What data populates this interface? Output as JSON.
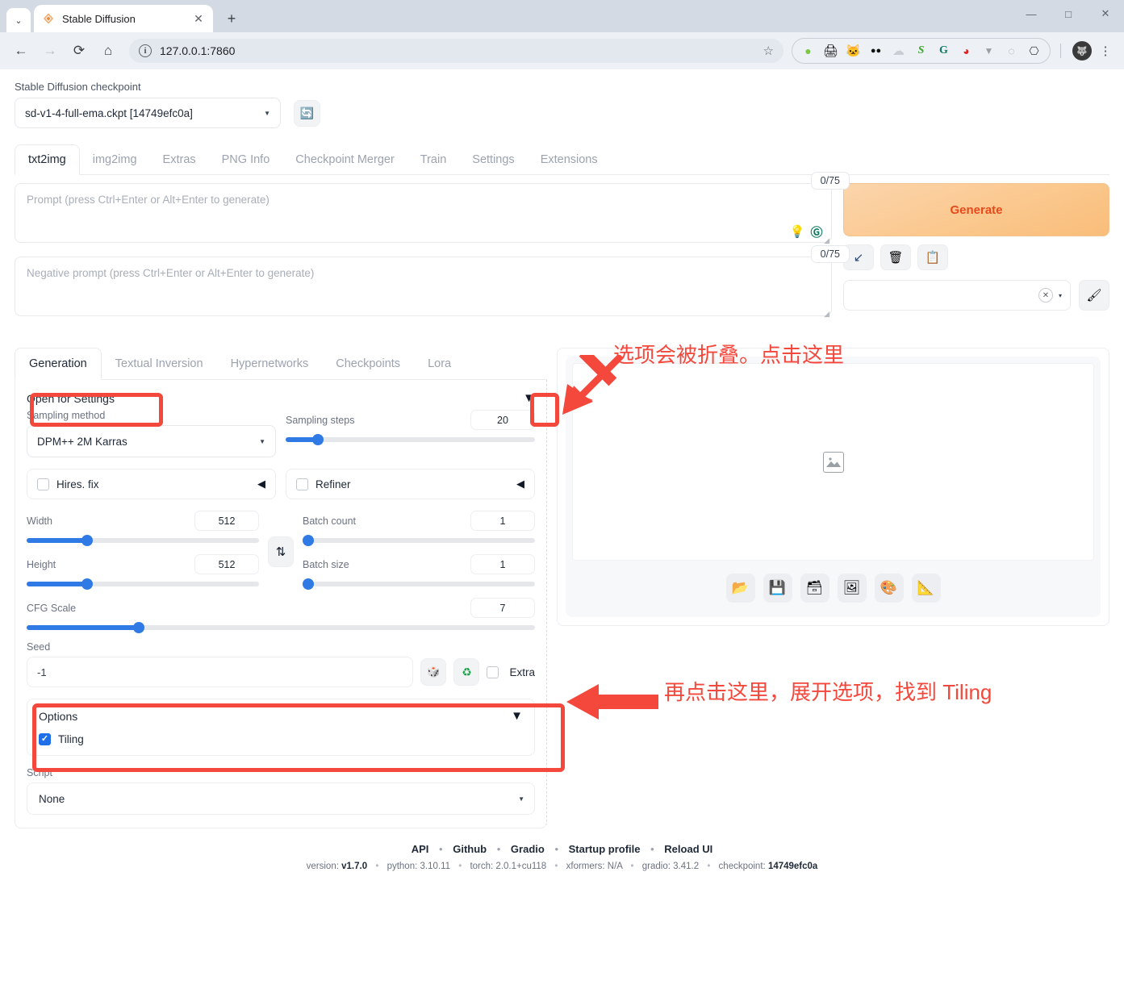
{
  "browser": {
    "tab": {
      "title": "Stable Diffusion",
      "favicon_icon": "stable-diffusion-favicon",
      "close_icon": "close-icon"
    },
    "new_tab_label": "+",
    "tab_list_icon": "chevron-down-icon",
    "window_controls": {
      "minimize": "—",
      "maximize": "□",
      "close": "✕"
    },
    "nav": {
      "back": "←",
      "forward": "→",
      "reload": "⟳",
      "home": "⌂"
    },
    "omnibox": {
      "url": "127.0.0.1:7860",
      "info_icon": "i",
      "star_icon": "☆"
    },
    "extensions": [
      {
        "name": "green-circle-extension",
        "glyph": "●",
        "color": "#7ac943"
      },
      {
        "name": "printer-extension",
        "glyph": "🖨",
        "color": "#2f86d6"
      },
      {
        "name": "pink-cat-extension",
        "glyph": "🐱",
        "color": "#f08fb0"
      },
      {
        "name": "dark-dots-extension",
        "glyph": "●●",
        "color": "#111111"
      },
      {
        "name": "cloud-extension",
        "glyph": "☁",
        "color": "#c9ccd2"
      },
      {
        "name": "s-letter-extension",
        "glyph": "S",
        "color": "#3ea832"
      },
      {
        "name": "grammarly-extension",
        "glyph": "G",
        "color": "#0f7a62"
      },
      {
        "name": "opera-extension",
        "glyph": "◕",
        "color": "#e41f1f"
      },
      {
        "name": "v-triangle-extension",
        "glyph": "▼",
        "color": "#9aa0a6"
      },
      {
        "name": "nls-extension",
        "glyph": "◌",
        "color": "#9aa0a6"
      },
      {
        "name": "puzzle-extension",
        "glyph": "⬚",
        "color": "#3c4043"
      }
    ],
    "profile_icon": "profile-avatar",
    "menu_icon": "kebab-menu-icon"
  },
  "sd": {
    "checkpoint_label": "Stable Diffusion checkpoint",
    "checkpoint_value": "sd-v1-4-full-ema.ckpt [14749efc0a]",
    "refresh_icon": "refresh-icon",
    "main_tabs": [
      {
        "label": "txt2img",
        "active": true
      },
      {
        "label": "img2img",
        "active": false
      },
      {
        "label": "Extras",
        "active": false
      },
      {
        "label": "PNG Info",
        "active": false
      },
      {
        "label": "Checkpoint Merger",
        "active": false
      },
      {
        "label": "Train",
        "active": false
      },
      {
        "label": "Settings",
        "active": false
      },
      {
        "label": "Extensions",
        "active": false
      }
    ],
    "prompt": {
      "placeholder": "Prompt (press Ctrl+Enter or Alt+Enter to generate)",
      "value": "",
      "token_count": "0/75",
      "icons": [
        "idea-bulb-icon",
        "grammarly-icon"
      ]
    },
    "negative_prompt": {
      "placeholder": "Negative prompt (press Ctrl+Enter or Alt+Enter to generate)",
      "value": "",
      "token_count": "0/75"
    },
    "generate_label": "Generate",
    "action_buttons": [
      {
        "name": "read-generation-params-button",
        "glyph": "↙"
      },
      {
        "name": "clear-prompt-button",
        "glyph": "🗑"
      },
      {
        "name": "paste-styles-button",
        "glyph": "📋"
      }
    ],
    "styles": {
      "value": "",
      "clear_glyph": "✕",
      "caret_glyph": "▾",
      "apply_icon": "paintbrush-icon"
    },
    "sub_tabs": [
      {
        "label": "Generation",
        "active": true
      },
      {
        "label": "Textual Inversion",
        "active": false
      },
      {
        "label": "Hypernetworks",
        "active": false
      },
      {
        "label": "Checkpoints",
        "active": false
      },
      {
        "label": "Lora",
        "active": false
      }
    ],
    "settings_accordion": {
      "title": "Open for Settings",
      "caret": "▼"
    },
    "sampling_method": {
      "label": "Sampling method",
      "value": "DPM++ 2M Karras"
    },
    "sampling_steps": {
      "label": "Sampling steps",
      "value": "20",
      "percent": 13
    },
    "hires_fix": {
      "label": "Hires. fix",
      "checked": false,
      "caret": "◀"
    },
    "refiner": {
      "label": "Refiner",
      "checked": false,
      "caret": "◀"
    },
    "width": {
      "label": "Width",
      "value": "512",
      "percent": 26
    },
    "height": {
      "label": "Height",
      "value": "512",
      "percent": 26
    },
    "swap_icon": "swap-dimensions-icon",
    "swap_glyph": "⇅",
    "batch_count": {
      "label": "Batch count",
      "value": "1",
      "percent": 0
    },
    "batch_size": {
      "label": "Batch size",
      "value": "1",
      "percent": 0
    },
    "cfg_scale": {
      "label": "CFG Scale",
      "value": "7",
      "percent": 22
    },
    "seed": {
      "label": "Seed",
      "value": "-1"
    },
    "seed_buttons": [
      {
        "name": "random-seed-dice-icon",
        "glyph": "🎲"
      },
      {
        "name": "recycle-seed-icon",
        "glyph": "♻"
      }
    ],
    "extra_checkbox": {
      "label": "Extra",
      "checked": false
    },
    "options": {
      "title": "Options",
      "caret": "▼",
      "tiling": {
        "label": "Tiling",
        "checked": true
      }
    },
    "script": {
      "label": "Script",
      "value": "None"
    },
    "result": {
      "placeholder_icon": "image-placeholder-icon"
    },
    "result_tools": [
      {
        "name": "open-folder-button",
        "glyph": "📂"
      },
      {
        "name": "save-button",
        "glyph": "💾"
      },
      {
        "name": "save-zip-button",
        "glyph": "🗃"
      },
      {
        "name": "send-to-img2img-button",
        "glyph": "🖼"
      },
      {
        "name": "send-to-inpaint-button",
        "glyph": "🎨"
      },
      {
        "name": "send-to-extras-button",
        "glyph": "📐"
      }
    ],
    "footer": {
      "links": [
        "API",
        "Github",
        "Gradio",
        "Startup profile",
        "Reload UI"
      ],
      "separator": "•",
      "version_items": [
        {
          "key": "version:",
          "value": "v1.7.0"
        },
        {
          "key": "python:",
          "value": "3.10.11"
        },
        {
          "key": "torch:",
          "value": "2.0.1+cu118"
        },
        {
          "key": "xformers:",
          "value": "N/A"
        },
        {
          "key": "gradio:",
          "value": "3.41.2"
        },
        {
          "key": "checkpoint:",
          "value": "14749efc0a"
        }
      ]
    }
  },
  "annotations": {
    "color": "#f4483c",
    "note_1": "选项会被折叠。点击这里",
    "note_2": "再点击这里，展开选项，找到 Tiling"
  }
}
